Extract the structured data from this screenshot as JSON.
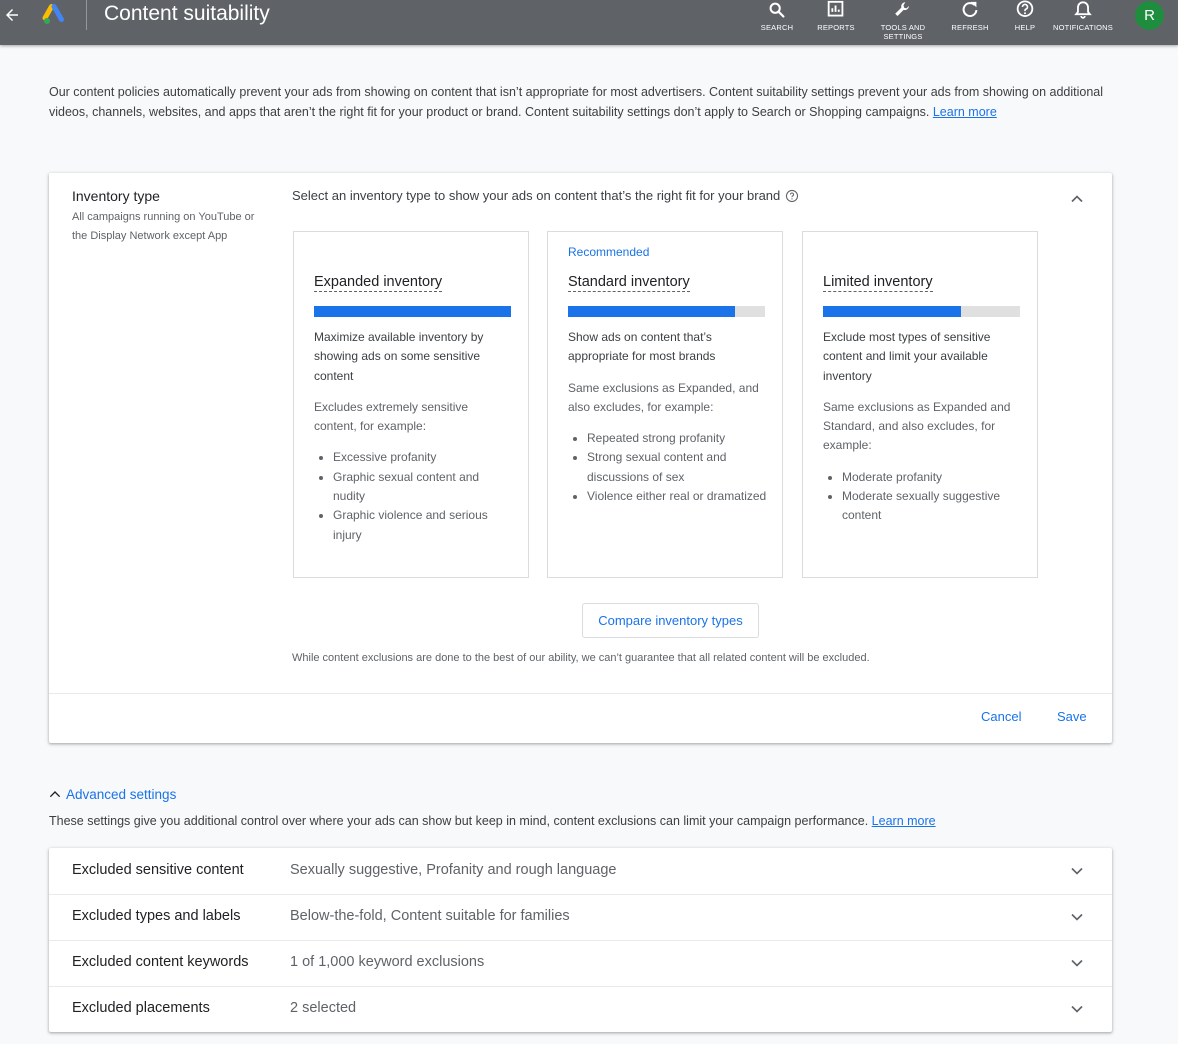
{
  "header": {
    "title": "Content suitability",
    "actions": [
      {
        "label": "SEARCH",
        "icon": "search-icon"
      },
      {
        "label": "REPORTS",
        "icon": "reports-icon"
      },
      {
        "label": "TOOLS AND\nSETTINGS",
        "icon": "wrench-icon"
      },
      {
        "label": "REFRESH",
        "icon": "refresh-icon"
      },
      {
        "label": "HELP",
        "icon": "help-icon"
      },
      {
        "label": "NOTIFICATIONS",
        "icon": "bell-icon"
      }
    ],
    "avatar_initial": "R"
  },
  "intro": {
    "text": "Our content policies automatically prevent your ads from showing on content that isn’t appropriate for most advertisers. Content suitability settings prevent your ads from showing on additional videos, channels, websites, and apps that aren’t the right fit for your product or brand. Content suitability settings don’t apply to Search or Shopping campaigns.",
    "link": "Learn more"
  },
  "inventory": {
    "label": "Inventory type",
    "sublabel": "All campaigns running on YouTube or the Display Network except App",
    "description": "Select an inventory type to show your ads on content that’s the right fit for your brand",
    "options": [
      {
        "recommended": "",
        "title": "Expanded inventory",
        "level": 1.0,
        "summary": "Maximize available inventory by showing ads on some sensitive content",
        "detail": "Excludes extremely sensitive content, for example:",
        "examples": [
          "Excessive profanity",
          "Graphic sexual content and nudity",
          "Graphic violence and serious injury"
        ]
      },
      {
        "recommended": "Recommended",
        "title": "Standard inventory",
        "level": 0.85,
        "summary": "Show ads on content that’s appropriate for most brands",
        "detail": "Same exclusions as Expanded, and also excludes, for example:",
        "examples": [
          "Repeated strong profanity",
          "Strong sexual content and discussions of sex",
          "Violence either real or dramatized"
        ]
      },
      {
        "recommended": "",
        "title": "Limited inventory",
        "level": 0.7,
        "summary": "Exclude most types of sensitive content and limit your available inventory",
        "detail": "Same exclusions as Expanded and Standard, and also excludes, for example:",
        "examples": [
          "Moderate profanity",
          "Moderate sexually suggestive content"
        ]
      }
    ],
    "compare_button": "Compare inventory types",
    "disclaimer": "While content exclusions are done to the best of our ability, we can’t guarantee that all related content will be excluded.",
    "cancel": "Cancel",
    "save": "Save"
  },
  "advanced": {
    "toggle": "Advanced settings",
    "description": "These settings give you additional control over where your ads can show but keep in mind, content exclusions can limit your campaign performance.",
    "link": "Learn more",
    "rows": [
      {
        "name": "Excluded sensitive content",
        "value": "Sexually suggestive, Profanity and rough language"
      },
      {
        "name": "Excluded types and labels",
        "value": "Below-the-fold, Content suitable for families"
      },
      {
        "name": "Excluded content keywords",
        "value": "1 of 1,000 keyword exclusions"
      },
      {
        "name": "Excluded placements",
        "value": "2 selected"
      }
    ]
  },
  "colors": {
    "topbar": "#5f6368",
    "accent": "#1a73e8",
    "avatar": "#1e8e3e"
  }
}
